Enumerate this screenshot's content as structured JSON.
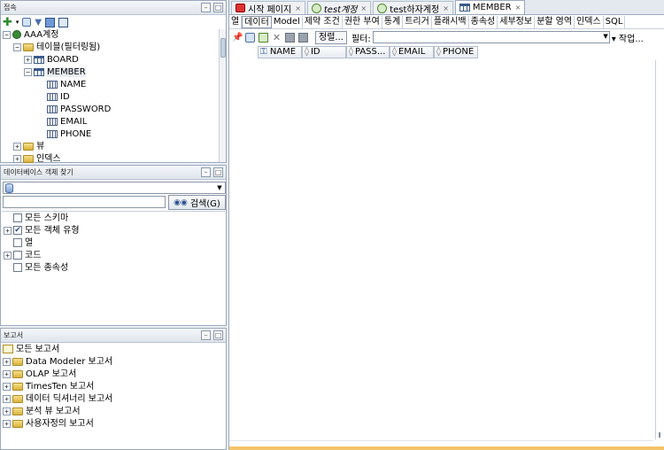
{
  "connections_panel": {
    "title": "접속",
    "tree": [
      {
        "label": "AAA계정",
        "level": 0,
        "expander": "−",
        "icon": "connection-icon"
      },
      {
        "label": "테이블(필터링됨)",
        "level": 1,
        "expander": "−",
        "icon": "folder-icon"
      },
      {
        "label": "BOARD",
        "level": 2,
        "expander": "+",
        "icon": "table-icon"
      },
      {
        "label": "MEMBER",
        "level": 2,
        "expander": "−",
        "icon": "table-icon"
      },
      {
        "label": "NAME",
        "level": 3,
        "icon": "column-icon"
      },
      {
        "label": "ID",
        "level": 3,
        "icon": "column-icon"
      },
      {
        "label": "PASSWORD",
        "level": 3,
        "icon": "column-icon"
      },
      {
        "label": "EMAIL",
        "level": 3,
        "icon": "column-icon"
      },
      {
        "label": "PHONE",
        "level": 3,
        "icon": "column-icon"
      },
      {
        "label": "뷰",
        "level": 1,
        "expander": "+",
        "icon": "folder-icon"
      },
      {
        "label": "인덱스",
        "level": 1,
        "expander": "+",
        "icon": "folder-icon"
      }
    ]
  },
  "find_panel": {
    "title": "데이터베이스 객체 찾기",
    "search_button": "검색(G)",
    "options": [
      {
        "label": "모든 스키마",
        "checked": false,
        "expander": ""
      },
      {
        "label": "모든 객체 유형",
        "checked": true,
        "expander": "+"
      },
      {
        "label": "열",
        "checked": false,
        "expander": ""
      },
      {
        "label": "코드",
        "checked": false,
        "expander": "+"
      },
      {
        "label": "모든 종속성",
        "checked": false,
        "expander": ""
      }
    ]
  },
  "reports_panel": {
    "title": "보고서",
    "items": [
      {
        "label": "모든 보고서",
        "level": 0
      },
      {
        "label": "Data Modeler 보고서",
        "level": 1
      },
      {
        "label": "OLAP 보고서",
        "level": 1
      },
      {
        "label": "TimesTen 보고서",
        "level": 1
      },
      {
        "label": "데이터 딕셔너리 보고서",
        "level": 1
      },
      {
        "label": "분석 뷰 보고서",
        "level": 1
      },
      {
        "label": "사용자정의 보고서",
        "level": 1
      }
    ]
  },
  "doc_tabs": [
    {
      "label": "시작 페이지",
      "icon": "start-page-icon",
      "active": false,
      "italic": false
    },
    {
      "label": "test계정",
      "icon": "sql-worksheet-icon",
      "active": false,
      "italic": true
    },
    {
      "label": "test하자계정",
      "icon": "sql-worksheet-icon",
      "active": false,
      "italic": false
    },
    {
      "label": "MEMBER",
      "icon": "table-icon",
      "active": true,
      "italic": false
    }
  ],
  "sub_tabs": [
    "열",
    "데이터",
    "Model",
    "제약 조건",
    "권한 부여",
    "통계",
    "트리거",
    "플래시백",
    "종속성",
    "세부정보",
    "분할 영역",
    "인덱스",
    "SQL"
  ],
  "active_sub_tab": "데이터",
  "toolbar": {
    "sort_label": "정렬...",
    "filter_label": "필터:",
    "filter_value": "",
    "actions_label": "▾ 작업..."
  },
  "grid_columns": [
    "NAME",
    "ID",
    "PASS...",
    "EMAIL",
    "PHONE"
  ],
  "colors": {
    "accent": "#3b5a8a",
    "panel_border": "#9aa9bc",
    "status_strip": "#f3c46a"
  }
}
